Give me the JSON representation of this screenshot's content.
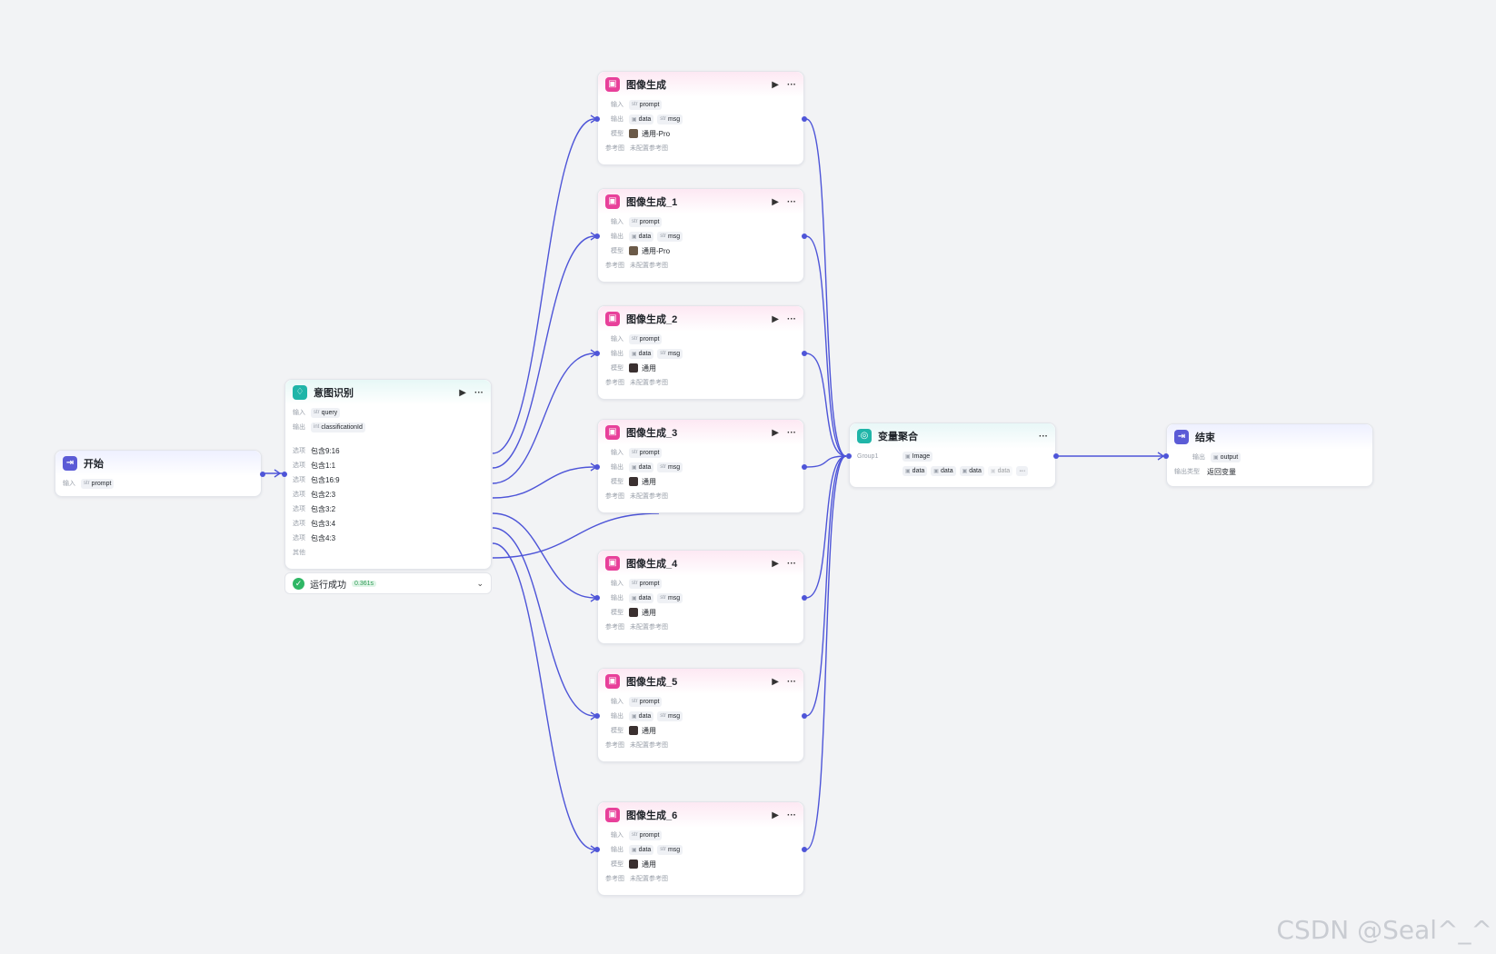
{
  "labels": {
    "input": "输入",
    "output": "输出",
    "model": "模型",
    "reference": "参考图",
    "option": "选项",
    "other": "其他",
    "output_type": "输出类型"
  },
  "type_tags": {
    "str": "str",
    "int": "int"
  },
  "start_node": {
    "title": "开始",
    "input_var": "prompt"
  },
  "intent_node": {
    "title": "意图识别",
    "input_var": "query",
    "output_var": "classificationId",
    "options": [
      "包含9:16",
      "包含1:1",
      "包含16:9",
      "包含2:3",
      "包含3:2",
      "包含3:4",
      "包含4:3"
    ],
    "status_text": "运行成功",
    "duration": "0.361s"
  },
  "image_nodes": [
    {
      "title": "图像生成",
      "input_var": "prompt",
      "out1": "data",
      "out2": "msg",
      "model": "通用-Pro",
      "ref": "未配置参考图"
    },
    {
      "title": "图像生成_1",
      "input_var": "prompt",
      "out1": "data",
      "out2": "msg",
      "model": "通用-Pro",
      "ref": "未配置参考图"
    },
    {
      "title": "图像生成_2",
      "input_var": "prompt",
      "out1": "data",
      "out2": "msg",
      "model": "通用",
      "ref": "未配置参考图"
    },
    {
      "title": "图像生成_3",
      "input_var": "prompt",
      "out1": "data",
      "out2": "msg",
      "model": "通用",
      "ref": "未配置参考图"
    },
    {
      "title": "图像生成_4",
      "input_var": "prompt",
      "out1": "data",
      "out2": "msg",
      "model": "通用",
      "ref": "未配置参考图"
    },
    {
      "title": "图像生成_5",
      "input_var": "prompt",
      "out1": "data",
      "out2": "msg",
      "model": "通用",
      "ref": "未配置参考图"
    },
    {
      "title": "图像生成_6",
      "input_var": "prompt",
      "out1": "data",
      "out2": "msg",
      "model": "通用",
      "ref": "未配置参考图"
    }
  ],
  "aggregate_node": {
    "title": "变量聚合",
    "group": "Group1",
    "group_var": "Image",
    "vars": [
      "data",
      "data",
      "data",
      "data"
    ]
  },
  "end_node": {
    "title": "结束",
    "output_var": "output",
    "output_type": "返回变量"
  },
  "watermark": "CSDN @Seal^_^",
  "colors": {
    "edge": "#4e55d8",
    "image_icon": "#e8409a",
    "intent_icon": "#1fb5a8",
    "start_icon": "#5b5bd6",
    "status_ok": "#2fb765"
  }
}
